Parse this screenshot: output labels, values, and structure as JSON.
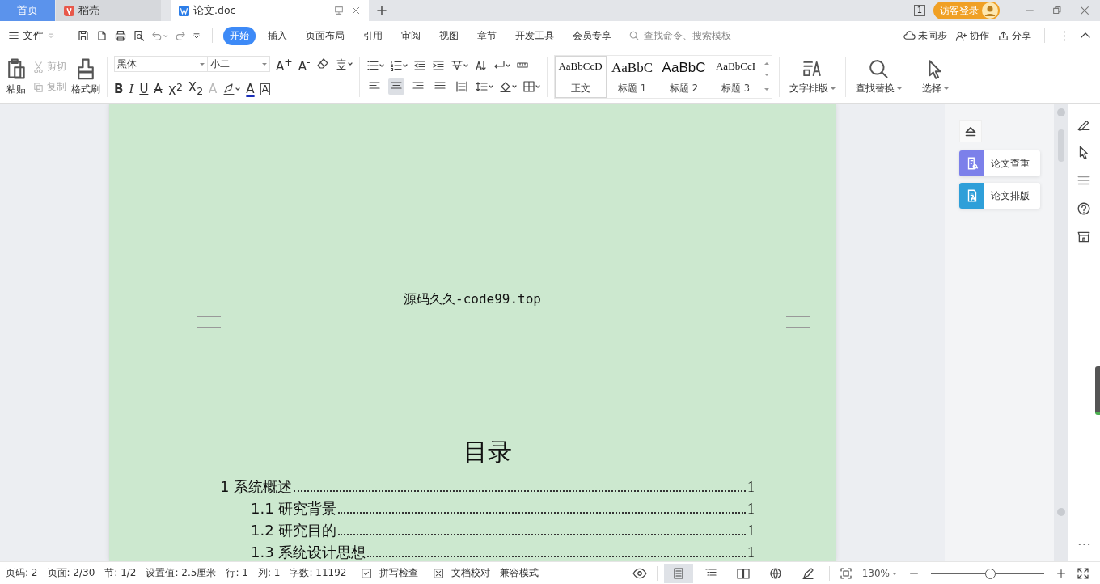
{
  "tabs": [
    {
      "label": "首页",
      "kind": "home",
      "selected": false
    },
    {
      "label": "稻壳",
      "kind": "docer",
      "selected": false
    },
    {
      "label": "论文.doc",
      "kind": "doc",
      "selected": true
    }
  ],
  "title_bar": {
    "page_badge": "1",
    "login": "访客登录"
  },
  "menu": {
    "file": "文件",
    "tabs": [
      {
        "label": "开始",
        "selected": true
      },
      {
        "label": "插入",
        "selected": false
      },
      {
        "label": "页面布局",
        "selected": false
      },
      {
        "label": "引用",
        "selected": false
      },
      {
        "label": "审阅",
        "selected": false
      },
      {
        "label": "视图",
        "selected": false
      },
      {
        "label": "章节",
        "selected": false
      },
      {
        "label": "开发工具",
        "selected": false
      },
      {
        "label": "会员专享",
        "selected": false
      }
    ],
    "search": {
      "placeholder": "查找命令、搜索模板"
    },
    "actions": [
      {
        "label": "未同步",
        "kind": "sync"
      },
      {
        "label": "协作",
        "kind": "collab"
      },
      {
        "label": "分享",
        "kind": "share"
      }
    ]
  },
  "ribbon": {
    "paste": "粘贴",
    "cut": {
      "label": "剪切",
      "disabled": true
    },
    "copy": {
      "label": "复制",
      "disabled": true
    },
    "format_painter": "格式刷",
    "font": {
      "value": "黑体"
    },
    "size": {
      "value": "小二"
    },
    "size_buttons": [
      {
        "label": "A$^{+}$"
      },
      {
        "label": "A$^{-}$"
      }
    ],
    "format_buttons": [
      {
        "label": "B",
        "kind": "bold"
      },
      {
        "label": "I",
        "kind": "italic"
      },
      {
        "label": "U",
        "kind": "underline"
      },
      {
        "label": "A",
        "kind": "strike"
      },
      {
        "label": "X$^{2}$",
        "kind": "superscript"
      },
      {
        "label": "X$_{2}$",
        "kind": "subscript"
      },
      {
        "label": "A",
        "kind": "effect"
      },
      {
        "label": "A",
        "kind": "color"
      },
      {
        "label": "A",
        "kind": "border"
      }
    ],
    "alignment": [
      {
        "kind": "left",
        "selected": false
      },
      {
        "kind": "center",
        "selected": true
      },
      {
        "kind": "right",
        "selected": false
      },
      {
        "kind": "justify",
        "selected": false
      },
      {
        "kind": "distributed",
        "selected": false
      }
    ],
    "styles": [
      {
        "preview": "AaBbCcD",
        "label": "正文",
        "kind": "body",
        "selected": true
      },
      {
        "preview": "AaBbC",
        "label": "标题 1",
        "kind": "h1",
        "selected": false
      },
      {
        "preview": "AaBbC",
        "label": "标题 2",
        "kind": "h2",
        "selected": false
      },
      {
        "preview": "AaBbCcI",
        "label": "标题 3",
        "kind": "h3",
        "selected": false
      }
    ],
    "big_buttons": [
      {
        "label": "文字排版",
        "kind": "layout"
      },
      {
        "label": "查找替换",
        "kind": "find"
      },
      {
        "label": "选择",
        "kind": "select"
      }
    ]
  },
  "document": {
    "header": "源码久久-code99.top",
    "toc_title": "目录",
    "toc": [
      {
        "text": "1 系统概述",
        "page": "1",
        "children": [
          {
            "text": "1.1  研究背景",
            "page": "1"
          },
          {
            "text": "1.2 研究目的",
            "page": "1"
          },
          {
            "text": "1.3 系统设计思想",
            "page": "1"
          }
        ]
      }
    ]
  },
  "side_panel": [
    {
      "label": "论文查重",
      "kind": "check",
      "color": "#7c80ea"
    },
    {
      "label": "论文排版",
      "kind": "format",
      "color": "#2e9fd9"
    }
  ],
  "status_bar": {
    "fields": [
      "页码: 2",
      "页面: 2/30",
      "节: 1/2",
      "设置值: 2.5厘米",
      "行: 1",
      "列: 1",
      "字数: 11192"
    ],
    "toggles": [
      {
        "label": "拼写检查",
        "kind": "spell"
      },
      {
        "label": "文档校对",
        "kind": "proof"
      }
    ],
    "mode": "兼容模式",
    "views": [
      {
        "kind": "page",
        "selected": true
      },
      {
        "kind": "outline",
        "selected": false
      },
      {
        "kind": "read",
        "selected": false
      },
      {
        "kind": "web",
        "selected": false
      },
      {
        "kind": "write",
        "selected": false
      }
    ],
    "zoom": "130%",
    "zoom_slider": {
      "level": 0.52
    }
  }
}
